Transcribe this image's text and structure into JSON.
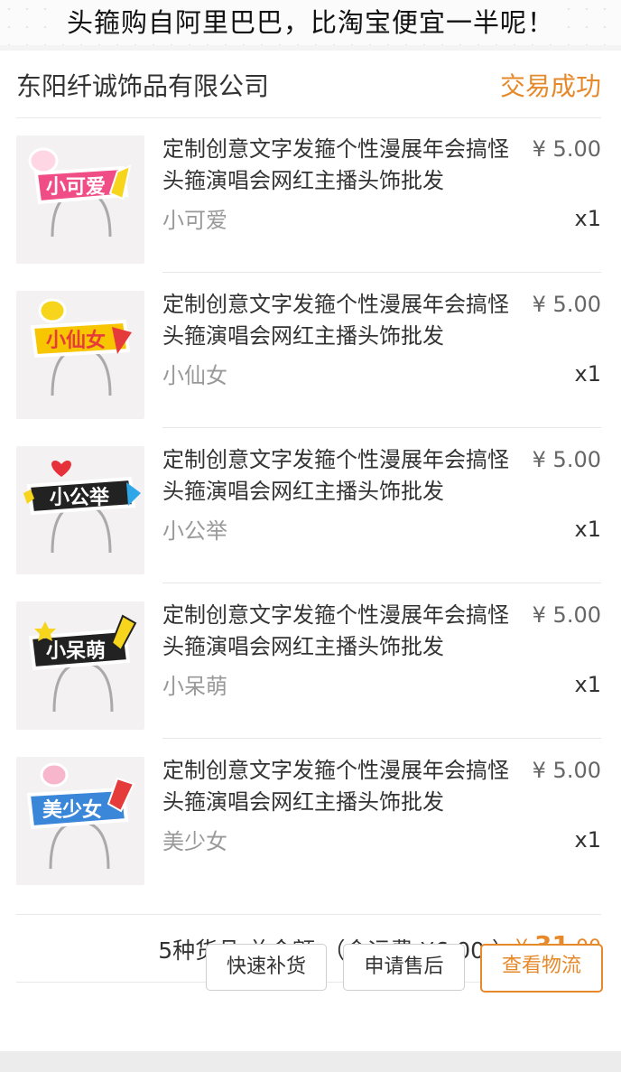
{
  "banner": {
    "text": "头箍购自阿里巴巴，比淘宝便宜一半呢！"
  },
  "order": {
    "shop_name": "东阳纤诚饰品有限公司",
    "status": "交易成功",
    "items": [
      {
        "title": "定制创意文字发箍个性漫展年会搞怪头箍演唱会网红主播头饰批发",
        "price": "¥ 5.00",
        "variant": "小可爱",
        "qty": "x1",
        "thumb_text": "小可爱",
        "thumb_color": "#f04d86"
      },
      {
        "title": "定制创意文字发箍个性漫展年会搞怪头箍演唱会网红主播头饰批发",
        "price": "¥ 5.00",
        "variant": "小仙女",
        "qty": "x1",
        "thumb_text": "小仙女",
        "thumb_color": "#f5c400"
      },
      {
        "title": "定制创意文字发箍个性漫展年会搞怪头箍演唱会网红主播头饰批发",
        "price": "¥ 5.00",
        "variant": "小公举",
        "qty": "x1",
        "thumb_text": "小公举",
        "thumb_color": "#222222"
      },
      {
        "title": "定制创意文字发箍个性漫展年会搞怪头箍演唱会网红主播头饰批发",
        "price": "¥ 5.00",
        "variant": "小呆萌",
        "qty": "x1",
        "thumb_text": "小呆萌",
        "thumb_color": "#222222"
      },
      {
        "title": "定制创意文字发箍个性漫展年会搞怪头箍演唱会网红主播头饰批发",
        "price": "¥ 5.00",
        "variant": "美少女",
        "qty": "x1",
        "thumb_text": "美少女",
        "thumb_color": "#3a86d9"
      }
    ],
    "summary": {
      "text": "5种货品 总金额:（含运费 ¥6.00 ）",
      "currency": "¥",
      "amount_int": "31",
      "amount_dec": ".00"
    },
    "actions": {
      "restock": "快速补货",
      "after_sale": "申请售后",
      "logistics": "查看物流"
    }
  },
  "colors": {
    "accent": "#e6892b"
  }
}
